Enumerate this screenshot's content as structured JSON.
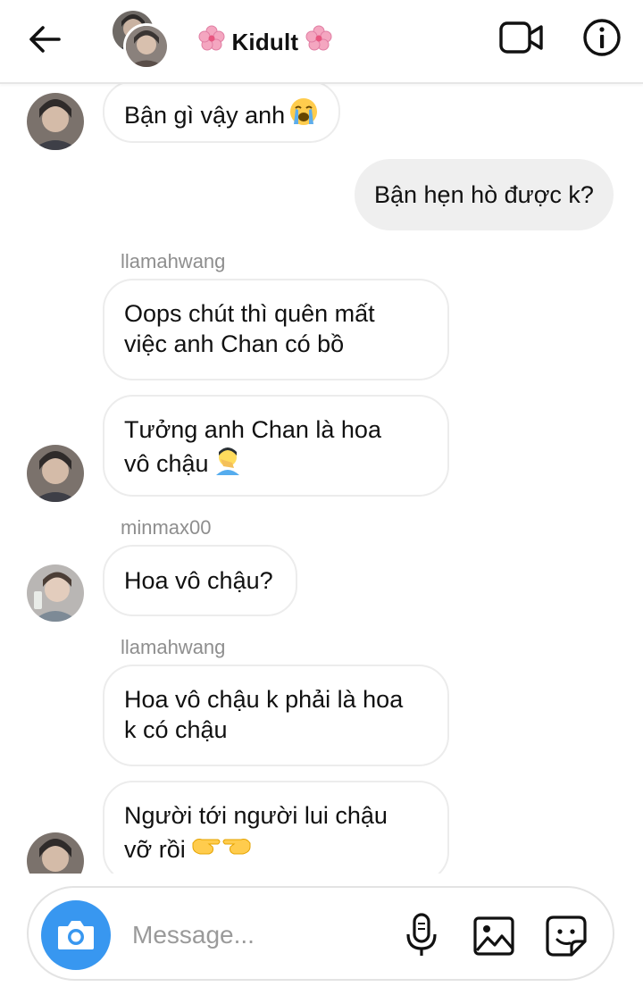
{
  "header": {
    "title": "Kidult",
    "title_emoji": "cherry-blossom-emoji",
    "back_icon": "arrow-left-icon",
    "video_icon": "video-camera-icon",
    "info_icon": "info-icon"
  },
  "messages": [
    {
      "direction": "incoming",
      "sender": "",
      "text": "Bận gì vậy anh",
      "emoji": "loudly-crying-face"
    },
    {
      "direction": "outgoing",
      "text": "Bận hẹn hò được k?"
    },
    {
      "direction": "incoming",
      "sender": "llamahwang",
      "lines": [
        "Oops chút thì quên mất",
        "việc anh Chan có bồ"
      ]
    },
    {
      "direction": "incoming",
      "sender": "",
      "lines": [
        "Tưởng anh Chan là hoa",
        "vô chậu"
      ],
      "emoji": "man-facepalming"
    },
    {
      "direction": "incoming",
      "sender": "minmax00",
      "text": "Hoa vô chậu?"
    },
    {
      "direction": "incoming",
      "sender": "llamahwang",
      "lines": [
        "Hoa vô chậu k phải là hoa",
        "k có chậu"
      ]
    },
    {
      "direction": "incoming",
      "sender": "",
      "lines": [
        "Người tới người lui chậu",
        "vỡ rồi"
      ],
      "emoji": "backhand-index-pointing-right-and-left"
    }
  ],
  "composer": {
    "placeholder": "Message...",
    "camera_icon": "camera-icon",
    "mic_icon": "microphone-icon",
    "gallery_icon": "image-icon",
    "sticker_icon": "sticker-icon"
  },
  "colors": {
    "accent": "#3897f0",
    "outgoing_bubble": "#efefef",
    "incoming_border": "#ececec",
    "secondary_text": "#8e8e8e"
  }
}
